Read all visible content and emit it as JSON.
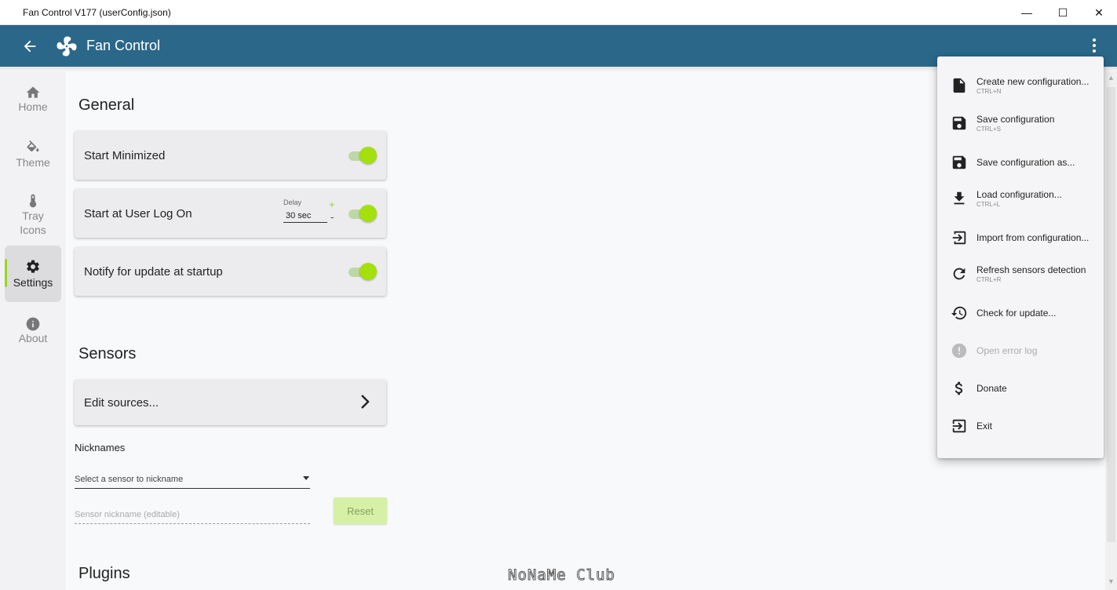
{
  "window": {
    "title": "Fan Control V177 (userConfig.json)",
    "minimize_glyph": "—",
    "maximize_glyph": "☐",
    "close_glyph": "✕"
  },
  "appbar": {
    "title": "Fan Control",
    "back_icon": "arrow-left-icon",
    "logo_icon": "fan-icon",
    "menu_icon": "kebab-menu-icon",
    "color": "#2b6789"
  },
  "sidebar": {
    "items": [
      {
        "label": "Home",
        "icon": "home-icon",
        "active": false
      },
      {
        "label": "Theme",
        "icon": "paint-bucket-icon",
        "active": false
      },
      {
        "label": "Tray\nIcons",
        "icon": "thermometer-icon",
        "active": false
      },
      {
        "label": "Settings",
        "icon": "gear-icon",
        "active": true
      },
      {
        "label": "About",
        "icon": "info-icon",
        "active": false
      }
    ],
    "accent": "#9ad41b"
  },
  "general": {
    "title": "General",
    "start_minimized": {
      "label": "Start Minimized",
      "enabled": true
    },
    "start_logon": {
      "label": "Start at User Log On",
      "delay_label": "Delay",
      "delay_value": "30 sec",
      "plus": "+",
      "minus": "-",
      "enabled": true
    },
    "notify_update": {
      "label": "Notify for update at startup",
      "enabled": true
    }
  },
  "sensors": {
    "title": "Sensors",
    "edit_sources": "Edit sources...",
    "nicknames_label": "Nicknames",
    "select_placeholder": "Select a sensor to nickname",
    "nickname_placeholder": "Sensor nickname (editable)",
    "reset_label": "Reset"
  },
  "plugins": {
    "title": "Plugins"
  },
  "watermark": "NoNaMe Club",
  "menu": {
    "items": [
      {
        "label": "Create new configuration...",
        "shortcut": "CTRL+N",
        "icon": "new-file-icon",
        "disabled": false
      },
      {
        "label": "Save configuration",
        "shortcut": "CTRL+S",
        "icon": "save-icon",
        "disabled": false
      },
      {
        "label": "Save configuration as...",
        "shortcut": "",
        "icon": "save-as-icon",
        "disabled": false
      },
      {
        "label": "Load configuration...",
        "shortcut": "CTRL+L",
        "icon": "download-icon",
        "disabled": false
      },
      {
        "label": "Import from configuration...",
        "shortcut": "",
        "icon": "import-icon",
        "disabled": false
      },
      {
        "label": "Refresh sensors detection",
        "shortcut": "CTRL+R",
        "icon": "refresh-icon",
        "disabled": false
      },
      {
        "label": "Check for update...",
        "shortcut": "",
        "icon": "history-icon",
        "disabled": false
      },
      {
        "label": "Open error log",
        "shortcut": "",
        "icon": "error-icon",
        "disabled": true
      },
      {
        "label": "Donate",
        "shortcut": "",
        "icon": "dollar-icon",
        "disabled": false
      },
      {
        "label": "Exit",
        "shortcut": "",
        "icon": "exit-icon",
        "disabled": false
      }
    ]
  }
}
